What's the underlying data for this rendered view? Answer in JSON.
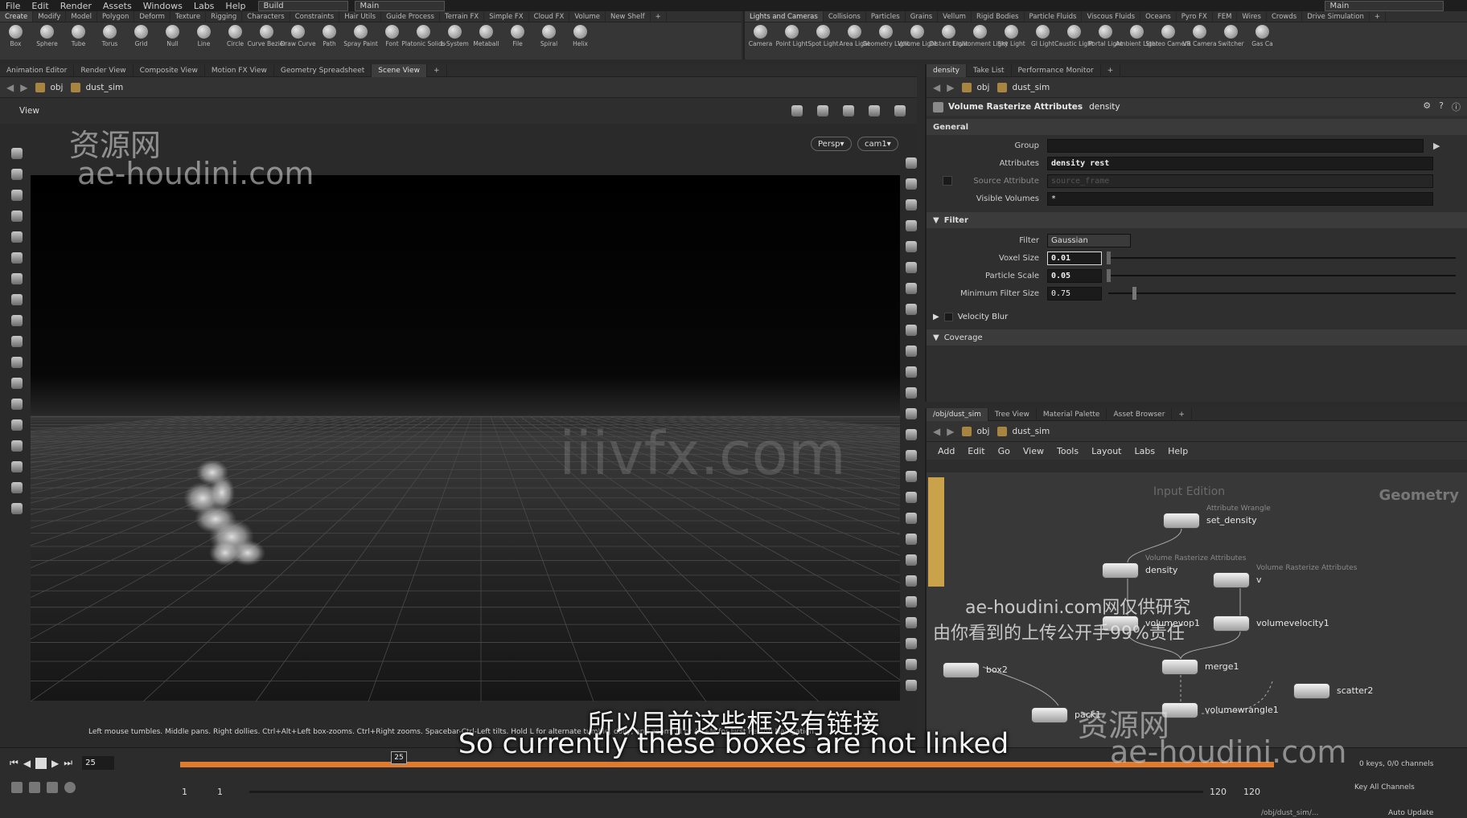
{
  "menu": {
    "items": [
      "File",
      "Edit",
      "Render",
      "Assets",
      "Windows",
      "Labs",
      "Help"
    ],
    "desktop": "Build",
    "desktop_context": "Main",
    "right_desktop": "Main"
  },
  "shelf_left": {
    "tabs": [
      "Create",
      "Modify",
      "Model",
      "Polygon",
      "Deform",
      "Texture",
      "Rigging",
      "Characters",
      "Constraints",
      "Hair Utils",
      "Guide Process",
      "Terrain FX",
      "Simple FX",
      "Cloud FX",
      "Volume",
      "New Shelf"
    ],
    "tools": [
      "Box",
      "Sphere",
      "Tube",
      "Torus",
      "Grid",
      "Null",
      "Line",
      "Circle",
      "Curve Bezier",
      "Draw Curve",
      "Path",
      "Spray Paint",
      "Font",
      "Platonic Solids",
      "L-System",
      "Metaball",
      "File",
      "Spiral",
      "Helix"
    ]
  },
  "shelf_right": {
    "tabs": [
      "Lights and Cameras",
      "Collisions",
      "Particles",
      "Grains",
      "Vellum",
      "Rigid Bodies",
      "Particle Fluids",
      "Viscous Fluids",
      "Oceans",
      "Pyro FX",
      "FEM",
      "Wires",
      "Crowds",
      "Drive Simulation"
    ],
    "tools": [
      "Camera",
      "Point Light",
      "Spot Light",
      "Area Light",
      "Geometry Light",
      "Volume Light",
      "Distant Light",
      "Environment Light",
      "Sky Light",
      "GI Light",
      "Caustic Light",
      "Portal Light",
      "Ambient Light",
      "Stereo Camera",
      "VR Camera",
      "Switcher",
      "Gas Ca"
    ]
  },
  "left_pane": {
    "tabs": [
      "Animation Editor",
      "Render View",
      "Composite View",
      "Motion FX View",
      "Geometry Spreadsheet",
      "Scene View"
    ],
    "path": [
      "obj",
      "dust_sim"
    ],
    "view_label": "View",
    "persp": "Persp",
    "cam": "cam1",
    "status_hint": "Left mouse tumbles. Middle pans. Right dollies. Ctrl+Alt+Left box-zooms. Ctrl+Right zooms. Spacebar-Ctrl-Left tilts. Hold L for alternate tumble, dolly, and zoom.  M or Alt+M for First Person Navigation."
  },
  "param_pane": {
    "tabs": [
      "density",
      "Take List",
      "Performance Monitor"
    ],
    "path": [
      "obj",
      "dust_sim"
    ],
    "node_type": "Volume Rasterize Attributes",
    "node_name": "density",
    "sections": {
      "general": "General",
      "filter": "Filter",
      "velocity_blur": "Velocity Blur",
      "coverage": "Coverage"
    },
    "params": {
      "group_label": "Group",
      "group_value": "",
      "attributes_label": "Attributes",
      "attributes_value": "density rest",
      "source_attribute_label": "Source Attribute",
      "source_attribute_value": "source_frame",
      "visible_volumes_label": "Visible Volumes",
      "visible_volumes_value": "*",
      "filter_label": "Filter",
      "filter_value": "Gaussian",
      "voxel_size_label": "Voxel Size",
      "voxel_size_value": "0.01",
      "particle_scale_label": "Particle Scale",
      "particle_scale_value": "0.05",
      "min_filter_size_label": "Minimum Filter Size",
      "min_filter_size_value": "0.75"
    }
  },
  "network_pane": {
    "tabs": [
      "/obj/dust_sim",
      "Tree View",
      "Material Palette",
      "Asset Browser"
    ],
    "path": [
      "obj",
      "dust_sim"
    ],
    "menu": [
      "Add",
      "Edit",
      "Go",
      "View",
      "Tools",
      "Layout",
      "Labs",
      "Help"
    ],
    "context_label": "Geometry",
    "input_edition": "Input Edition",
    "nodes": [
      {
        "name": "set_density",
        "type": "Attribute Wrangle"
      },
      {
        "name": "density",
        "type": "Volume Rasterize Attributes"
      },
      {
        "name": "v",
        "type": "Volume Rasterize Attributes"
      },
      {
        "name": "volumevop1",
        "type": ""
      },
      {
        "name": "volumevelocity1",
        "type": ""
      },
      {
        "name": "merge1",
        "type": ""
      },
      {
        "name": "box2",
        "type": ""
      },
      {
        "name": "pack1",
        "type": ""
      },
      {
        "name": "volumewrangle1",
        "type": ""
      },
      {
        "name": "scatter2",
        "type": ""
      }
    ]
  },
  "timeline": {
    "current_frame": "25",
    "marker": "25",
    "start": "1",
    "start2": "1",
    "end": "120",
    "end2": "120",
    "keys_info": "0 keys, 0/0 channels",
    "key_all": "Key All Channels",
    "status_path": "/obj/dust_sim/...",
    "auto_update": "Auto Update"
  },
  "subtitles": {
    "zh": "所以目前这些框没有链接",
    "en": "So currently these boxes are not linked"
  },
  "watermarks": {
    "wm1": "资源网",
    "wm2": "ae-houdini.com",
    "wm3": "iiivfx.com",
    "wm4": "ae-houdini.com网仅供研究",
    "wm5": "由你看到的上传公开手99%责任",
    "wm6": "资源网",
    "wm7": "ae-houdini.com"
  },
  "colors": {
    "accent_timeline": "#e07a2e",
    "node_tint": "#c9a24a",
    "viewport_bg": "#000000"
  }
}
